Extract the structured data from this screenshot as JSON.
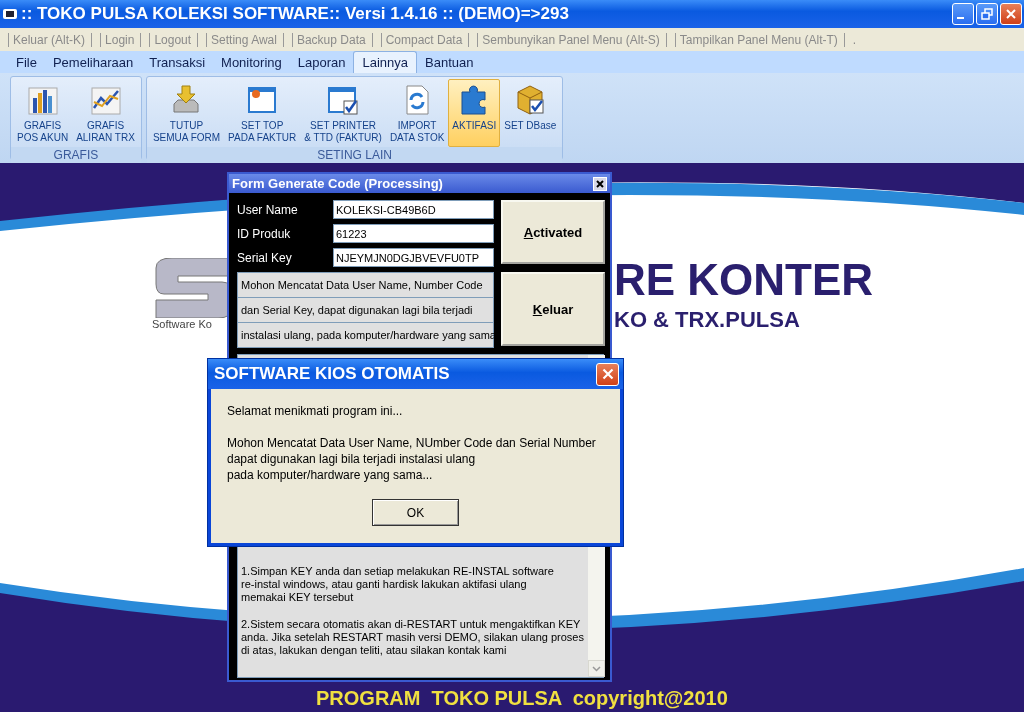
{
  "window": {
    "title": ":: TOKO PULSA KOLEKSI SOFTWARE:: Versi 1.4.16 :: (DEMO)=>293"
  },
  "menu_bar": {
    "items": [
      "Keluar (Alt-K)",
      "Login",
      "Logout",
      "Setting Awal",
      "Backup Data",
      "Compact Data",
      "Sembunyikan Panel Menu (Alt-S)",
      "Tampilkan Panel Menu (Alt-T)"
    ],
    "trailing": "."
  },
  "ribbon": {
    "tabs": [
      {
        "label": "File",
        "selected": false
      },
      {
        "label": "Pemeliharaan",
        "selected": false
      },
      {
        "label": "Transaksi",
        "selected": false
      },
      {
        "label": "Monitoring",
        "selected": false
      },
      {
        "label": "Laporan",
        "selected": false
      },
      {
        "label": "Lainnya",
        "selected": true
      },
      {
        "label": "Bantuan",
        "selected": false
      }
    ],
    "groups": [
      {
        "label": "GRAFIS",
        "buttons": [
          {
            "label": "GRAFIS\nPOS AKUN",
            "selected": false
          },
          {
            "label": "GRAFIS\nALIRAN TRX",
            "selected": false
          }
        ]
      },
      {
        "label": "SETING LAIN",
        "buttons": [
          {
            "label": "TUTUP\nSEMUA FORM",
            "selected": false
          },
          {
            "label": "SET TOP\nPADA FAKTUR",
            "selected": false
          },
          {
            "label": "SET PRINTER\n& TTD (FAKTUR)",
            "selected": false
          },
          {
            "label": "IMPORT\nDATA STOK",
            "selected": false
          },
          {
            "label": "AKTIFASI",
            "selected": true
          },
          {
            "label": "SET DBase",
            "selected": false
          }
        ]
      }
    ]
  },
  "background": {
    "heading": "RE KONTER",
    "subheading": "KO & TRX.PULSA",
    "tagline": "Software Ko",
    "footer": "PROGRAM  TOKO PULSA  copyright@2010"
  },
  "form": {
    "title": "Form Generate Code (Processing)",
    "fields": [
      {
        "label": "User Name",
        "value": "KOLEKSI-CB49B6D"
      },
      {
        "label": "ID Produk",
        "value": "61223"
      },
      {
        "label": "Serial Key",
        "value": "NJEYMJN0DGJBVEVFU0TP"
      }
    ],
    "buttons": [
      "Activated",
      "Keluar"
    ],
    "notice_lines": [
      "Mohon Mencatat Data User Name, Number Code",
      "dan Serial Key, dapat digunakan lagi bila terjadi",
      "instalasi ulang, pada komputer/hardware yang sama"
    ],
    "notes": [
      "1.Simpan KEY anda dan setiap melakukan RE-INSTAL software\nre-instal windows, atau ganti hardisk lakukan aktifasi ulang\nmemakai KEY tersebut",
      "2.Sistem secara otomatis akan di-RESTART untuk mengaktifkan KEY\nanda. Jika setelah RESTART masih versi DEMO, silakan ulang proses\ndi atas, lakukan dengan teliti, atau silakan kontak kami"
    ]
  },
  "dialog": {
    "title": "SOFTWARE KIOS OTOMATIS",
    "paragraphs": [
      "Selamat menikmati program ini...",
      "Mohon Mencatat Data User Name, NUmber Code dan Serial Number\ndapat digunakan lagi bila terjadi instalasi ulang\npada komputer/hardware yang sama..."
    ],
    "button": "OK"
  }
}
